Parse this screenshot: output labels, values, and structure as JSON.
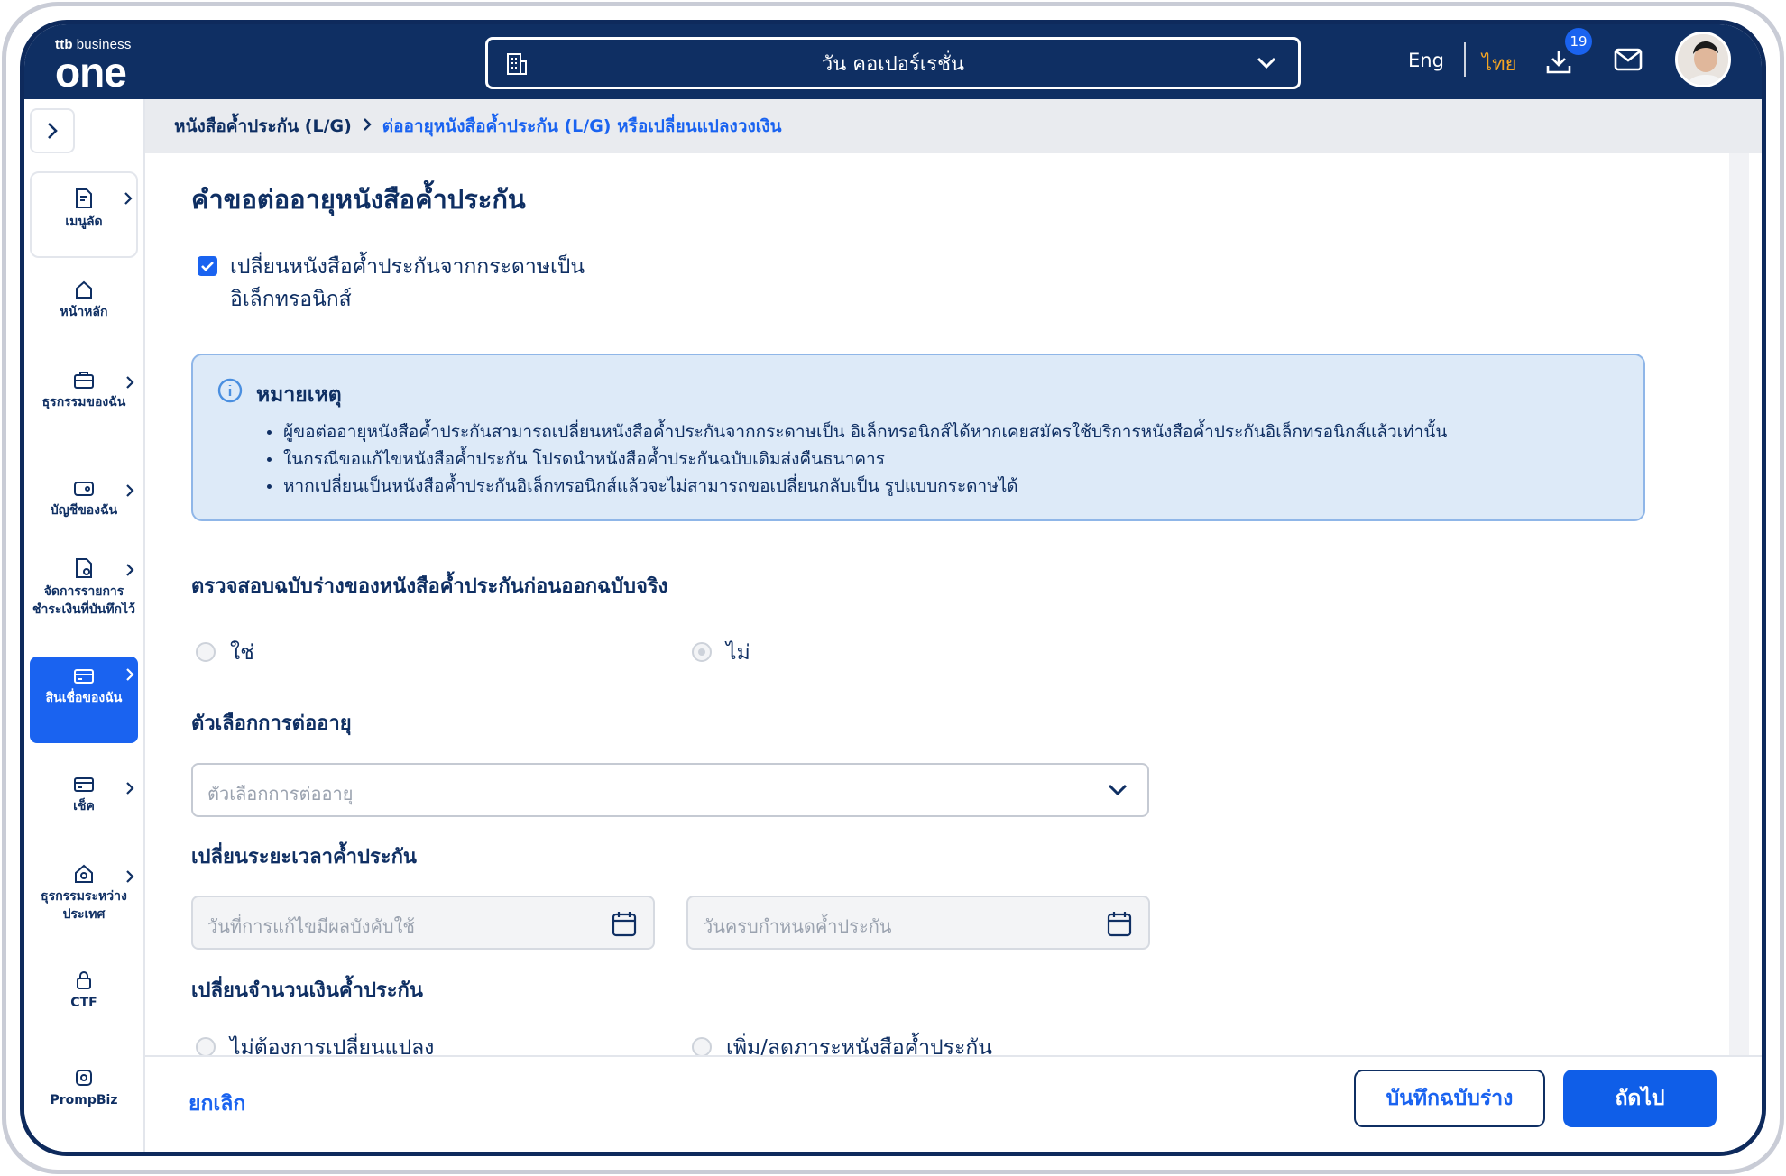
{
  "header": {
    "brand_small_bold": "ttb",
    "brand_small": "business",
    "brand_big": "one",
    "company": "วัน คอเปอร์เรชั่น",
    "lang_en": "Eng",
    "lang_th": "ไทย",
    "download_badge": "19",
    "colors": {
      "bar": "#0f2f63",
      "active_lang": "#f5a623",
      "badge": "#1a63f0"
    }
  },
  "sidebar": {
    "items": [
      {
        "label": "เมนูลัด",
        "icon": "shortcut-doc-icon"
      },
      {
        "label": "หน้าหลัก",
        "icon": "home-icon"
      },
      {
        "label": "ธุรกรรมของฉัน",
        "icon": "briefcase-icon"
      },
      {
        "label": "บัญชีของฉัน",
        "icon": "wallet-icon"
      },
      {
        "label": "จัดการรายการชำระเงินที่บันทึกไว้",
        "icon": "doc-settings-icon"
      },
      {
        "label": "สินเชื่อของฉัน",
        "icon": "credit-card-icon"
      },
      {
        "label": "เช็ค",
        "icon": "cheque-icon"
      },
      {
        "label": "ธุรกรรมระหว่างประเทศ",
        "icon": "global-home-icon"
      },
      {
        "label": "CTF",
        "icon": "lock-icon"
      },
      {
        "label": "PrompBiz",
        "icon": "prompbiz-icon"
      }
    ],
    "active_color": "#1a63f0"
  },
  "breadcrumb": {
    "parent": "หนังสือค้ำประกัน (L/G)",
    "current": "ต่ออายุหนังสือค้ำประกัน (L/G) หรือเปลี่ยนแปลงวงเงิน"
  },
  "form": {
    "title": "คำขอต่ออายุหนังสือค้ำประกัน",
    "checkbox_label": "เปลี่ยนหนังสือค้ำประกันจากกระดาษเป็น อิเล็กทรอนิกส์",
    "checkbox_checked": true,
    "note": {
      "title": "หมายเหตุ",
      "items": [
        "ผู้ขอต่ออายุหนังสือค้ำประกันสามารถเปลี่ยนหนังสือค้ำประกันจากกระดาษเป็น อิเล็กทรอนิกส์ได้หากเคยสมัครใช้บริการหนังสือค้ำประกันอิเล็กทรอนิกส์แล้วเท่านั้น",
        "ในกรณีขอแก้ไขหนังสือค้ำประกัน โปรดนำหนังสือค้ำประกันฉบับเดิมส่งคืนธนาคาร",
        "หากเปลี่ยนเป็นหนังสือค้ำประกันอิเล็กทรอนิกส์แล้วจะไม่สามารถขอเปลี่ยนกลับเป็น รูปแบบกระดาษได้"
      ]
    },
    "draft_check": {
      "label": "ตรวจสอบฉบับร่างของหนังสือค้ำประกันก่อนออกฉบับจริง",
      "yes": "ใช่",
      "no": "ไม่",
      "selected": "ไม่"
    },
    "renew_option": {
      "label": "ตัวเลือกการต่ออายุ",
      "placeholder": "ตัวเลือกการต่ออายุ"
    },
    "period": {
      "label": "เปลี่ยนระยะเวลาค้ำประกัน",
      "effective_placeholder": "วันที่การแก้ไขมีผลบังคับใช้",
      "expiry_placeholder": "วันครบกำหนดค้ำประกัน"
    },
    "amount": {
      "label": "เปลี่ยนจำนวนเงินค้ำประกัน",
      "no_change": "ไม่ต้องการเปลี่ยนแปลง",
      "change": "เพิ่ม/ลดภาระหนังสือค้ำประกัน"
    }
  },
  "footer": {
    "cancel": "ยกเลิก",
    "save_draft": "บันทึกฉบับร่าง",
    "next": "ถัดไป"
  }
}
